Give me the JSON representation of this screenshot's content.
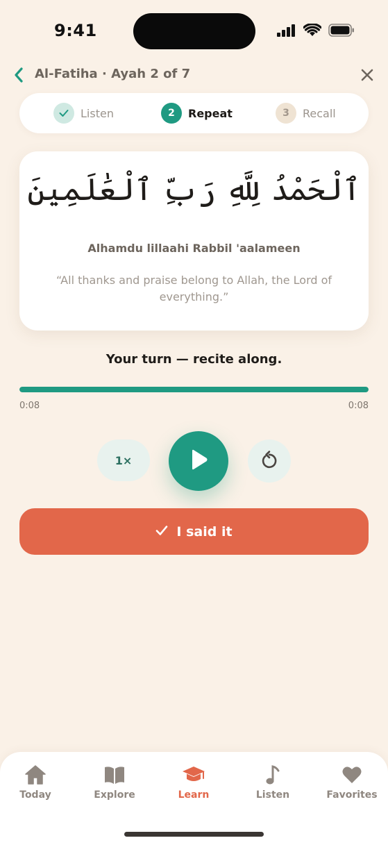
{
  "status_bar": {
    "time": "9:41"
  },
  "header": {
    "title": "Al-Fatiha · Ayah 2 of 7",
    "back_icon": "chevron-left-icon",
    "close_icon": "close-icon"
  },
  "stepper": {
    "steps": [
      {
        "badge": "✓",
        "label": "Listen",
        "state": "done"
      },
      {
        "badge": "2",
        "label": "Repeat",
        "state": "active"
      },
      {
        "badge": "3",
        "label": "Recall",
        "state": "upcoming"
      }
    ]
  },
  "ayah": {
    "arabic": "ٱلْحَمْدُ لِلَّهِ رَبِّ ٱلْعَٰلَمِينَ",
    "transliteration": "Alhamdu lillaahi Rabbil 'aalameen",
    "translation": "“All thanks and praise belong to Allah, the Lord of everything.”"
  },
  "prompt": "Your turn — recite along.",
  "player": {
    "current_time": "0:08",
    "duration": "0:08",
    "progress": 1.0,
    "speed_label": "1×"
  },
  "actions": {
    "said_it_label": "I said it"
  },
  "tabs": [
    {
      "label": "Today",
      "icon": "home-icon",
      "active": false
    },
    {
      "label": "Explore",
      "icon": "book-icon",
      "active": false
    },
    {
      "label": "Learn",
      "icon": "graduation-cap-icon",
      "active": true
    },
    {
      "label": "Listen",
      "icon": "music-note-icon",
      "active": false
    },
    {
      "label": "Favorites",
      "icon": "heart-icon",
      "active": false
    }
  ],
  "colors": {
    "accent": "#1f9a82",
    "primary_action": "#e2674a",
    "background": "#faf1e7"
  }
}
